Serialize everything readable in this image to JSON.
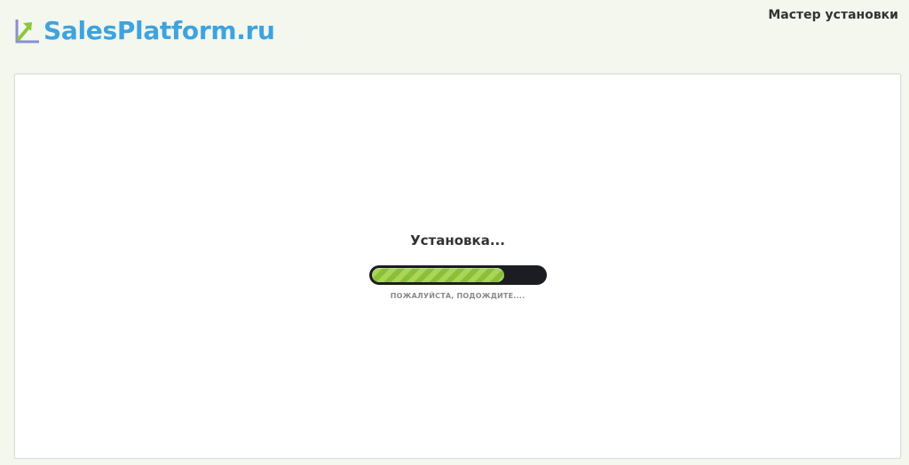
{
  "header": {
    "logo_text": "SalesPlatform.ru",
    "logo_icon": "chart-arrow-icon",
    "wizard_title": "Мастер установки"
  },
  "main": {
    "status_title": "Установка...",
    "progress": 0.77,
    "wait_text": "ПОЖАЛУЙСТА, ПОДОЖДИТЕ...."
  },
  "colors": {
    "page_background": "#f3f7ee",
    "logo_blue": "#3ea3df",
    "progress_green": "#9ccc4a",
    "progress_track": "#1b1d22"
  }
}
